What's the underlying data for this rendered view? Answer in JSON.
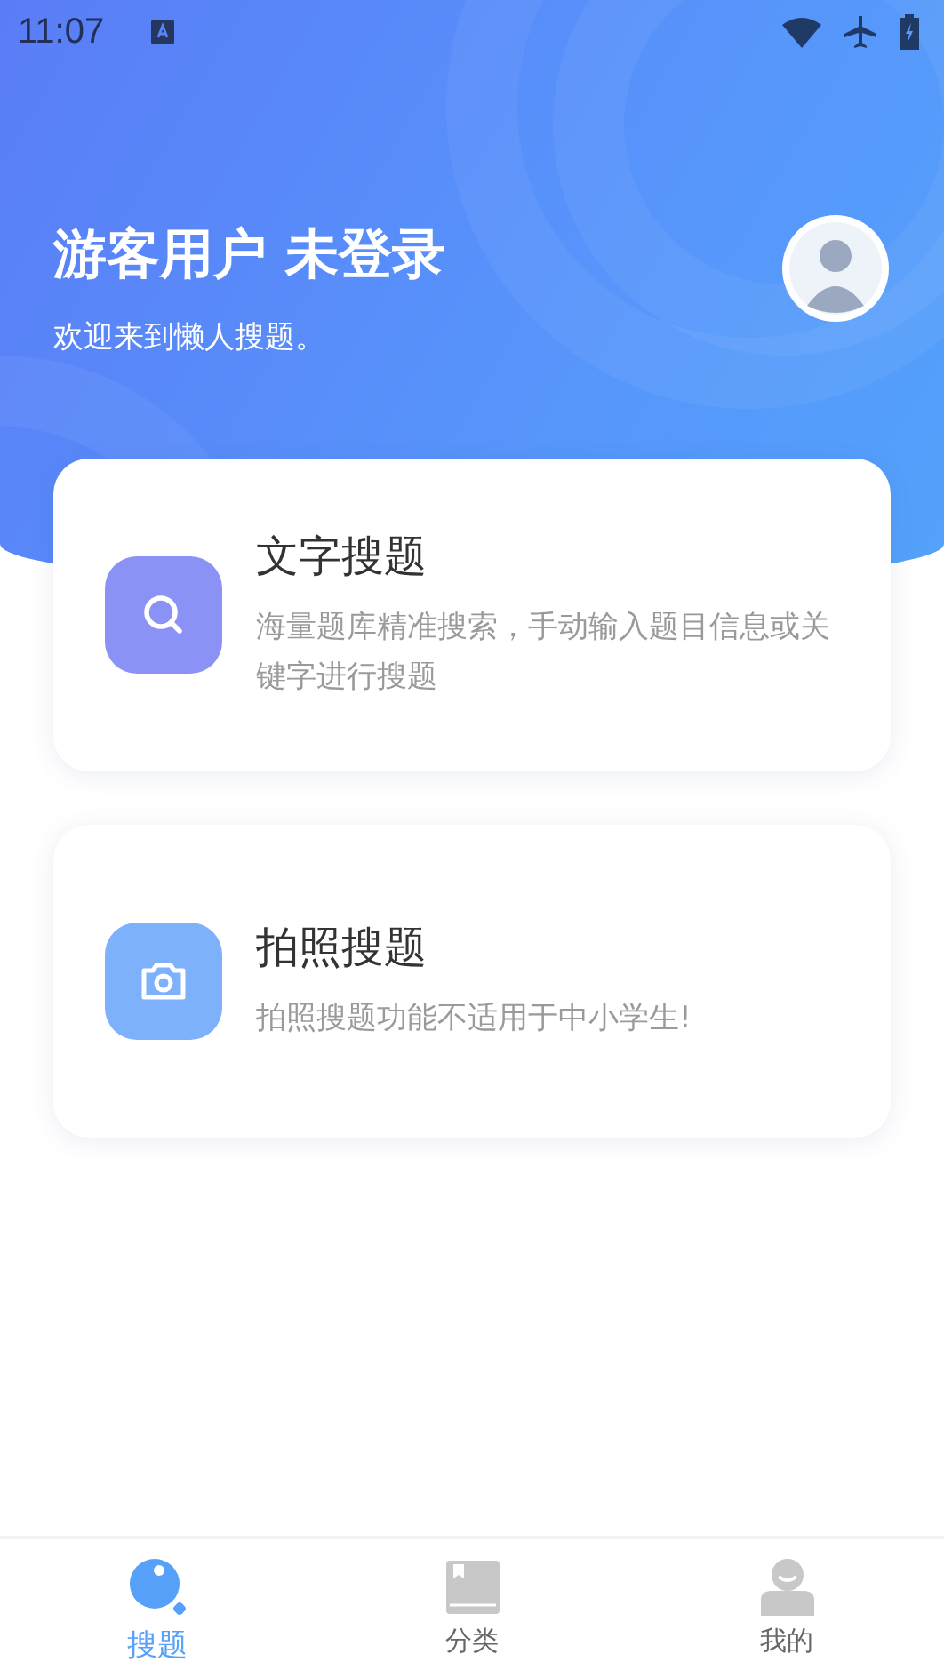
{
  "status_bar": {
    "time": "11:07"
  },
  "header": {
    "title": "游客用户 未登录",
    "subtitle": "欢迎来到懒人搜题。"
  },
  "cards": [
    {
      "kind": "text",
      "title": "文字搜题",
      "description": "海量题库精准搜索，手动输入题目信息或关键字进行搜题"
    },
    {
      "kind": "photo",
      "title": "拍照搜题",
      "description": "拍照搜题功能不适用于中小学生!"
    }
  ],
  "tabs": [
    {
      "kind": "search",
      "label": "搜题",
      "selected": true
    },
    {
      "kind": "book",
      "label": "分类",
      "selected": false
    },
    {
      "kind": "person",
      "label": "我的",
      "selected": false
    }
  ]
}
